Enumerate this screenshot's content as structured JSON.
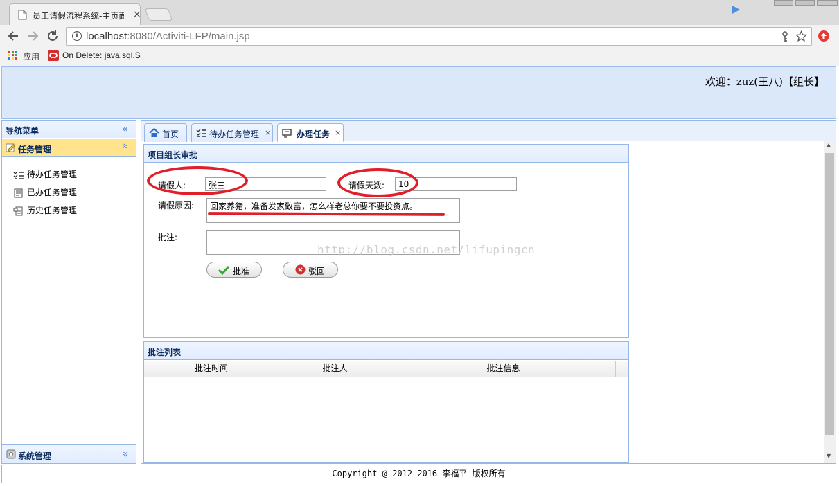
{
  "browser": {
    "tab_title": "员工请假流程系统-主页面",
    "url_host": "localhost",
    "url_rest": ":8080/Activiti-LFP/main.jsp",
    "bookmarks": [
      {
        "label": "应用"
      },
      {
        "label": "On Delete: java.sql.S"
      }
    ]
  },
  "header": {
    "welcome": "欢迎：zuz(王八)【组长】"
  },
  "sidebar": {
    "title": "导航菜单",
    "section_task": "任务管理",
    "items": [
      {
        "label": "待办任务管理"
      },
      {
        "label": "已办任务管理"
      },
      {
        "label": "历史任务管理"
      }
    ],
    "section_system": "系统管理"
  },
  "tabs": [
    {
      "label": "首页",
      "closable": false
    },
    {
      "label": "待办任务管理",
      "closable": true
    },
    {
      "label": "办理任务",
      "closable": true,
      "selected": true
    }
  ],
  "form": {
    "title": "项目组长审批",
    "applicant_label": "请假人:",
    "applicant_value": "张三",
    "days_label": "请假天数:",
    "days_value": "10",
    "reason_label": "请假原因:",
    "reason_value": "回家养猪，准备发家致富，怎么样老总你要不要投资点。",
    "comment_label": "批注:",
    "comment_value": "",
    "approve_label": "批准",
    "reject_label": "驳回"
  },
  "comments": {
    "title": "批注列表",
    "columns": [
      "批注时间",
      "批注人",
      "批注信息"
    ],
    "rows": []
  },
  "watermark": "http://blog.csdn.net/lifupingcn",
  "footer": "Copyright @ 2012-2016 李福平 版权所有",
  "colors": {
    "panel_border": "#95b8e7",
    "header_bg": "#dbe8fa",
    "selected_accordion": "#ffe48d",
    "annotation_red": "#e01f2a"
  }
}
